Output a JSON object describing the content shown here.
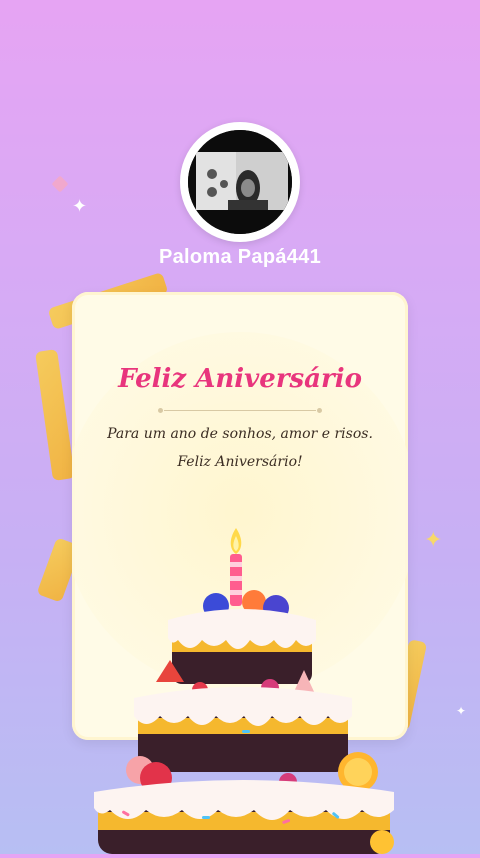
{
  "profile": {
    "name": "Paloma Papá441"
  },
  "card": {
    "title": "Feliz Aniversário",
    "line1": "Para um ano de sonhos, amor e risos.",
    "line2": "Feliz Aniversário!"
  },
  "colors": {
    "title": "#e8357d",
    "card_bg": "#fffbe7",
    "ribbon": "#f5c24a"
  },
  "icons": [
    "sparkle-icon",
    "diamond-icon",
    "birthday-cake-icon",
    "candle-icon"
  ]
}
